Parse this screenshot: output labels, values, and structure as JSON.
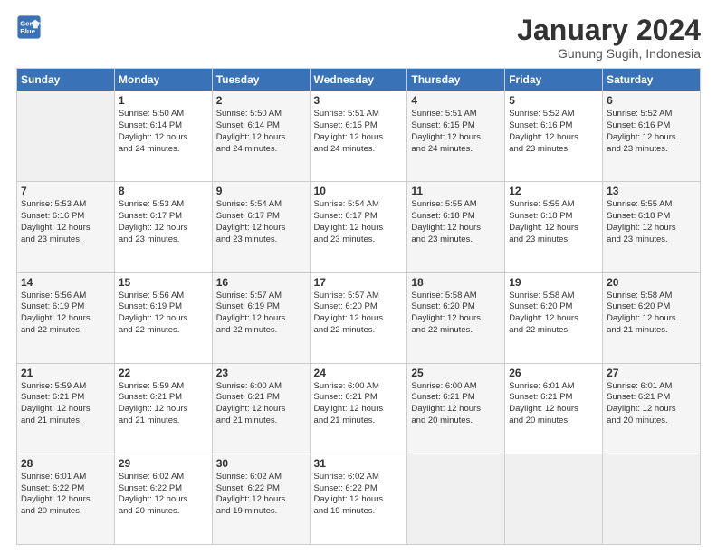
{
  "logo": {
    "line1": "General",
    "line2": "Blue"
  },
  "title": "January 2024",
  "subtitle": "Gunung Sugih, Indonesia",
  "weekdays": [
    "Sunday",
    "Monday",
    "Tuesday",
    "Wednesday",
    "Thursday",
    "Friday",
    "Saturday"
  ],
  "weeks": [
    [
      {
        "day": "",
        "info": ""
      },
      {
        "day": "1",
        "info": "Sunrise: 5:50 AM\nSunset: 6:14 PM\nDaylight: 12 hours\nand 24 minutes."
      },
      {
        "day": "2",
        "info": "Sunrise: 5:50 AM\nSunset: 6:14 PM\nDaylight: 12 hours\nand 24 minutes."
      },
      {
        "day": "3",
        "info": "Sunrise: 5:51 AM\nSunset: 6:15 PM\nDaylight: 12 hours\nand 24 minutes."
      },
      {
        "day": "4",
        "info": "Sunrise: 5:51 AM\nSunset: 6:15 PM\nDaylight: 12 hours\nand 24 minutes."
      },
      {
        "day": "5",
        "info": "Sunrise: 5:52 AM\nSunset: 6:16 PM\nDaylight: 12 hours\nand 23 minutes."
      },
      {
        "day": "6",
        "info": "Sunrise: 5:52 AM\nSunset: 6:16 PM\nDaylight: 12 hours\nand 23 minutes."
      }
    ],
    [
      {
        "day": "7",
        "info": "Sunrise: 5:53 AM\nSunset: 6:16 PM\nDaylight: 12 hours\nand 23 minutes."
      },
      {
        "day": "8",
        "info": "Sunrise: 5:53 AM\nSunset: 6:17 PM\nDaylight: 12 hours\nand 23 minutes."
      },
      {
        "day": "9",
        "info": "Sunrise: 5:54 AM\nSunset: 6:17 PM\nDaylight: 12 hours\nand 23 minutes."
      },
      {
        "day": "10",
        "info": "Sunrise: 5:54 AM\nSunset: 6:17 PM\nDaylight: 12 hours\nand 23 minutes."
      },
      {
        "day": "11",
        "info": "Sunrise: 5:55 AM\nSunset: 6:18 PM\nDaylight: 12 hours\nand 23 minutes."
      },
      {
        "day": "12",
        "info": "Sunrise: 5:55 AM\nSunset: 6:18 PM\nDaylight: 12 hours\nand 23 minutes."
      },
      {
        "day": "13",
        "info": "Sunrise: 5:55 AM\nSunset: 6:18 PM\nDaylight: 12 hours\nand 23 minutes."
      }
    ],
    [
      {
        "day": "14",
        "info": "Sunrise: 5:56 AM\nSunset: 6:19 PM\nDaylight: 12 hours\nand 22 minutes."
      },
      {
        "day": "15",
        "info": "Sunrise: 5:56 AM\nSunset: 6:19 PM\nDaylight: 12 hours\nand 22 minutes."
      },
      {
        "day": "16",
        "info": "Sunrise: 5:57 AM\nSunset: 6:19 PM\nDaylight: 12 hours\nand 22 minutes."
      },
      {
        "day": "17",
        "info": "Sunrise: 5:57 AM\nSunset: 6:20 PM\nDaylight: 12 hours\nand 22 minutes."
      },
      {
        "day": "18",
        "info": "Sunrise: 5:58 AM\nSunset: 6:20 PM\nDaylight: 12 hours\nand 22 minutes."
      },
      {
        "day": "19",
        "info": "Sunrise: 5:58 AM\nSunset: 6:20 PM\nDaylight: 12 hours\nand 22 minutes."
      },
      {
        "day": "20",
        "info": "Sunrise: 5:58 AM\nSunset: 6:20 PM\nDaylight: 12 hours\nand 21 minutes."
      }
    ],
    [
      {
        "day": "21",
        "info": "Sunrise: 5:59 AM\nSunset: 6:21 PM\nDaylight: 12 hours\nand 21 minutes."
      },
      {
        "day": "22",
        "info": "Sunrise: 5:59 AM\nSunset: 6:21 PM\nDaylight: 12 hours\nand 21 minutes."
      },
      {
        "day": "23",
        "info": "Sunrise: 6:00 AM\nSunset: 6:21 PM\nDaylight: 12 hours\nand 21 minutes."
      },
      {
        "day": "24",
        "info": "Sunrise: 6:00 AM\nSunset: 6:21 PM\nDaylight: 12 hours\nand 21 minutes."
      },
      {
        "day": "25",
        "info": "Sunrise: 6:00 AM\nSunset: 6:21 PM\nDaylight: 12 hours\nand 20 minutes."
      },
      {
        "day": "26",
        "info": "Sunrise: 6:01 AM\nSunset: 6:21 PM\nDaylight: 12 hours\nand 20 minutes."
      },
      {
        "day": "27",
        "info": "Sunrise: 6:01 AM\nSunset: 6:21 PM\nDaylight: 12 hours\nand 20 minutes."
      }
    ],
    [
      {
        "day": "28",
        "info": "Sunrise: 6:01 AM\nSunset: 6:22 PM\nDaylight: 12 hours\nand 20 minutes."
      },
      {
        "day": "29",
        "info": "Sunrise: 6:02 AM\nSunset: 6:22 PM\nDaylight: 12 hours\nand 20 minutes."
      },
      {
        "day": "30",
        "info": "Sunrise: 6:02 AM\nSunset: 6:22 PM\nDaylight: 12 hours\nand 19 minutes."
      },
      {
        "day": "31",
        "info": "Sunrise: 6:02 AM\nSunset: 6:22 PM\nDaylight: 12 hours\nand 19 minutes."
      },
      {
        "day": "",
        "info": ""
      },
      {
        "day": "",
        "info": ""
      },
      {
        "day": "",
        "info": ""
      }
    ]
  ]
}
